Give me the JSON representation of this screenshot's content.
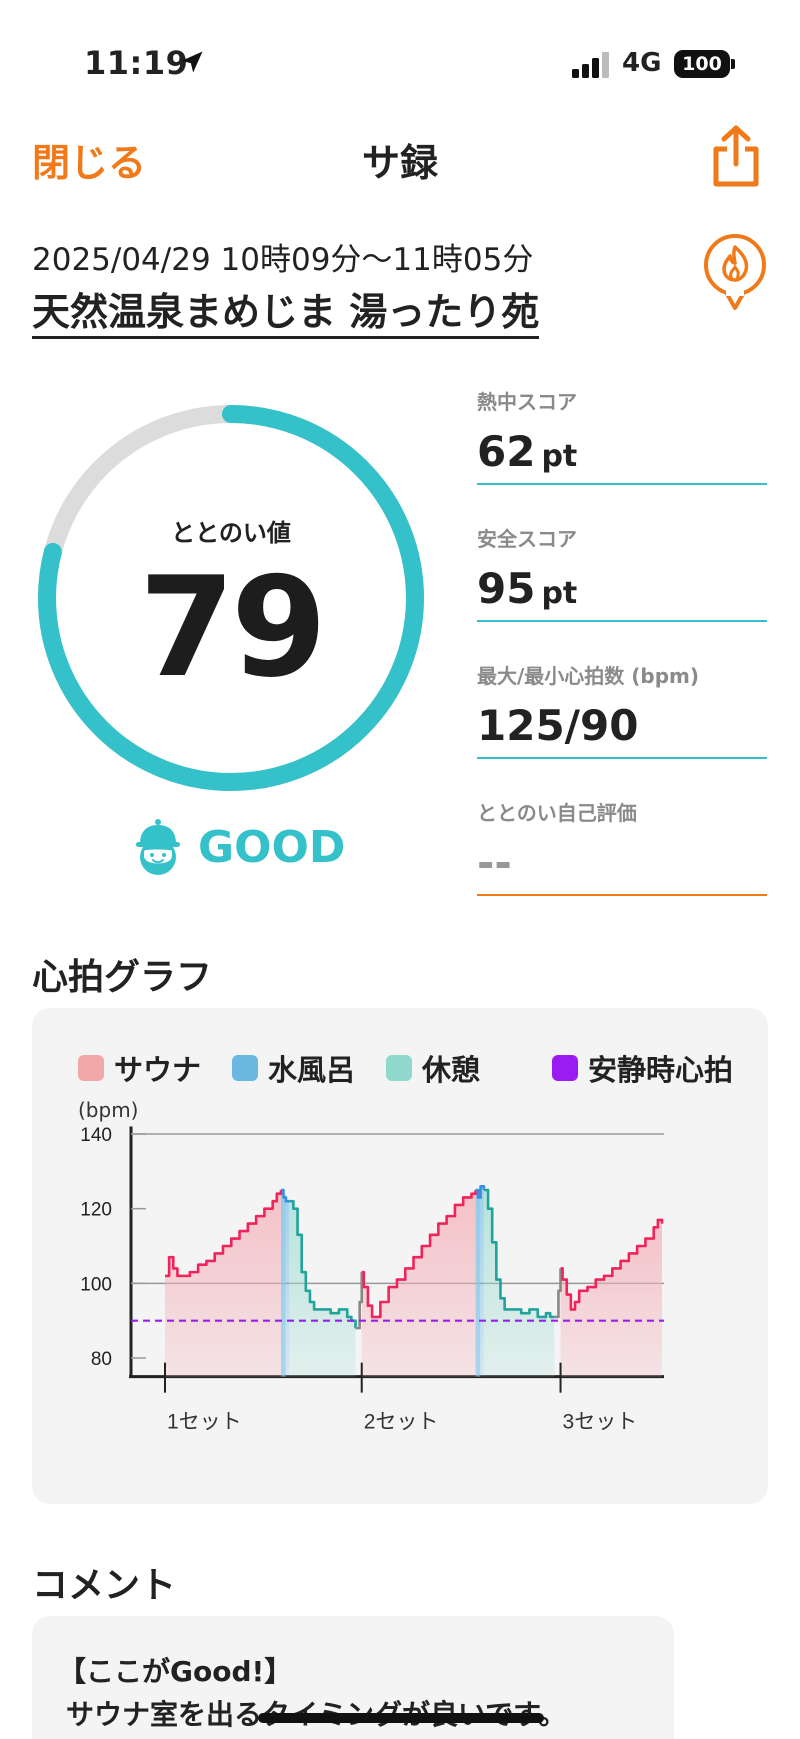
{
  "status": {
    "time": "11:19",
    "network": "4G",
    "battery": "100"
  },
  "nav": {
    "close_label": "閉じる",
    "title": "サ録"
  },
  "session": {
    "datetime": "2025/04/29 10時09分〜11時05分",
    "facility": "天然温泉まめじま 湯ったり苑"
  },
  "score": {
    "label": "ととのい値",
    "value": "79",
    "progress": 0.79,
    "rating": "GOOD"
  },
  "metrics": [
    {
      "label": "熱中スコア",
      "value": "62",
      "unit": "pt"
    },
    {
      "label": "安全スコア",
      "value": "95",
      "unit": "pt"
    },
    {
      "label": "最大/最小心拍数 (bpm)",
      "value": "125/90",
      "unit": ""
    },
    {
      "label": "ととのい自己評価",
      "value": "--",
      "unit": ""
    }
  ],
  "graph_section": {
    "title": "心拍グラフ"
  },
  "colors": {
    "accent": "#f07a1a",
    "teal": "#35c1c9",
    "sauna": "#e84a6b",
    "cold_bath": "#5aa8d8",
    "rest": "#2aa8a0",
    "resting_hr": "#9b1cf0"
  },
  "chart_data": {
    "type": "line",
    "title": "",
    "ylabel": "(bpm)",
    "ylim": [
      75,
      142
    ],
    "yticks": [
      80,
      100,
      120,
      140
    ],
    "x_tick_labels": [
      "1セット",
      "2セット",
      "3セット"
    ],
    "legend": [
      {
        "name": "サウナ",
        "color": "#f0a8a8"
      },
      {
        "name": "水風呂",
        "color": "#6ab8e2"
      },
      {
        "name": "休憩",
        "color": "#8fd8cc"
      },
      {
        "name": "安静時心拍",
        "color": "#9b1cf0"
      }
    ],
    "resting_hr": 90,
    "segments": [
      {
        "phase": "sauna",
        "x": [
          0,
          1,
          2,
          3,
          4,
          6,
          8,
          10,
          12,
          14,
          16,
          18,
          20,
          22,
          24,
          26,
          27,
          28
        ],
        "y": [
          102,
          107,
          104,
          102,
          102,
          103,
          105,
          106,
          108,
          110,
          112,
          114,
          116,
          118,
          120,
          122,
          124,
          125
        ]
      },
      {
        "phase": "cold",
        "x": [
          28,
          28.6,
          29.2,
          30
        ],
        "y": [
          125,
          123,
          122,
          122
        ]
      },
      {
        "phase": "rest",
        "x": [
          30,
          31,
          32,
          33,
          34,
          35,
          36,
          38,
          40,
          42,
          44,
          45,
          46
        ],
        "y": [
          122,
          120,
          113,
          103,
          98,
          95,
          93,
          93,
          92,
          93,
          91,
          90,
          88
        ]
      },
      {
        "phase": "transition",
        "x": [
          46,
          47,
          47.5
        ],
        "y": [
          88,
          95,
          103
        ]
      },
      {
        "phase": "sauna",
        "x": [
          47.5,
          48,
          49,
          50,
          51,
          52,
          54,
          56,
          58,
          60,
          62,
          64,
          66,
          68,
          70,
          72,
          74,
          75
        ],
        "y": [
          103,
          99,
          94,
          91,
          91,
          95,
          99,
          101,
          104,
          107,
          110,
          113,
          116,
          118,
          121,
          123,
          124,
          125
        ]
      },
      {
        "phase": "cold",
        "x": [
          75,
          75.6,
          76.2,
          77
        ],
        "y": [
          125,
          123,
          126,
          125
        ]
      },
      {
        "phase": "rest",
        "x": [
          77,
          78,
          79,
          80,
          81,
          82,
          84,
          86,
          88,
          90,
          92,
          93,
          94
        ],
        "y": [
          125,
          120,
          111,
          101,
          96,
          93,
          93,
          92,
          93,
          91,
          92,
          91,
          91
        ]
      },
      {
        "phase": "transition",
        "x": [
          94,
          95,
          95.5
        ],
        "y": [
          91,
          98,
          104
        ]
      },
      {
        "phase": "sauna",
        "x": [
          95.5,
          96,
          97,
          98,
          99,
          100,
          102,
          104,
          106,
          108,
          110,
          112,
          114,
          116,
          118,
          119,
          120
        ],
        "y": [
          104,
          101,
          97,
          93,
          95,
          98,
          99,
          101,
          102,
          104,
          106,
          108,
          110,
          112,
          115,
          117,
          116
        ]
      }
    ],
    "cold_bands": [
      [
        28,
        30
      ],
      [
        75,
        77
      ]
    ],
    "rest_bands": [
      [
        30,
        46
      ],
      [
        77,
        94
      ]
    ],
    "set_positions": [
      0,
      47.5,
      95.5
    ],
    "x_range": [
      0,
      120
    ]
  },
  "comment": {
    "title": "コメント",
    "heading": "【ここがGood!】",
    "body": "サウナ室を出るタイミングが良いです。"
  }
}
